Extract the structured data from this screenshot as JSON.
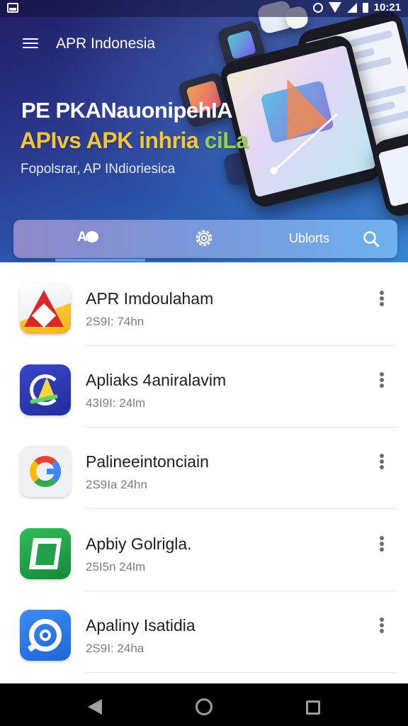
{
  "status_bar": {
    "time": "10:21",
    "icons": [
      "storage-icon",
      "alarm-icon",
      "wifi-icon",
      "signal-icon",
      "battery-icon"
    ]
  },
  "header": {
    "title": "APR Indonesia",
    "headline": "PE PKANauonipehIA",
    "subheadline_main": "APIvs APK inhria ",
    "subheadline_tail": "ciLa",
    "tagline": "Fopolsrar, AP INdioriesica",
    "colors": {
      "gradient_start": "#221d63",
      "gradient_end": "#3a86d2",
      "subheadline": "#f3c43a",
      "subheadline_tail": "#8fd14f"
    }
  },
  "tabs": {
    "home_label": "A",
    "updates_label": "Ublorts",
    "icons": {
      "home": "chat-bubble-icon",
      "settings": "gear-icon",
      "search": "search-icon"
    },
    "active": "home",
    "colors": {
      "bar_start": "#8e88c8",
      "bar_end": "#6fb1ef",
      "indicator": "#5a9de6"
    }
  },
  "apps": [
    {
      "name": "APR Imdoulaham",
      "meta": "2S9I: 74hn",
      "icon": "red-a-app-icon"
    },
    {
      "name": "Apliaks 4aniralavim",
      "meta": "43I9I: 24lm",
      "icon": "blue-compass-app-icon"
    },
    {
      "name": "Palineeintonciain",
      "meta": "2S9Ia 24hn",
      "icon": "google-g-app-icon"
    },
    {
      "name": "Apbiy Golrigla.",
      "meta": "25I5n 24lm",
      "icon": "green-box-app-icon"
    },
    {
      "name": "Apaliny Isatidia",
      "meta": "2S9I: 24ha",
      "icon": "blue-chat-app-icon"
    }
  ],
  "navigation_bar": {
    "icons": [
      "back-icon",
      "home-icon",
      "recents-icon"
    ]
  }
}
